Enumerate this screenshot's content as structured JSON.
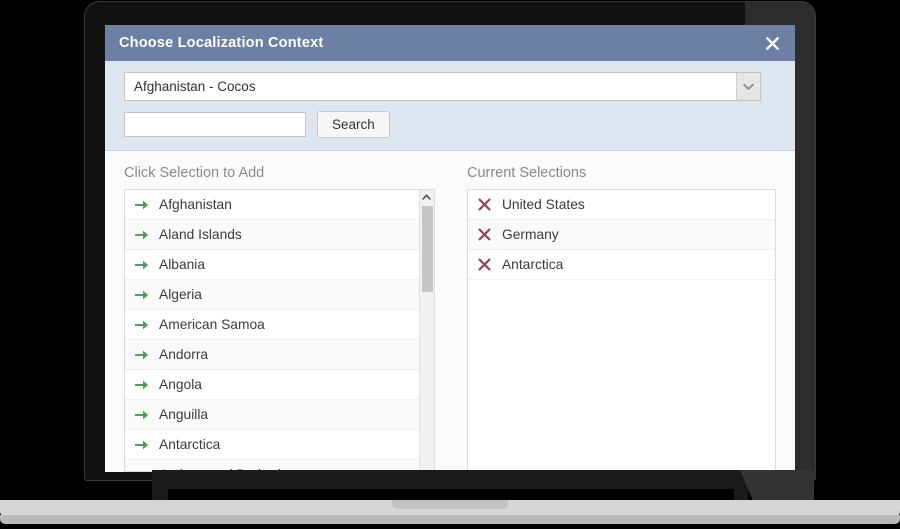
{
  "dialog": {
    "title": "Choose Localization Context",
    "close_icon": "close-icon"
  },
  "context_select": {
    "value": "Afghanistan - Cocos",
    "arrow_icon": "chevron-down-icon"
  },
  "search": {
    "value": "",
    "placeholder": "",
    "button_label": "Search"
  },
  "available": {
    "label": "Click Selection to Add",
    "row_icon": "green-arrow-right-icon",
    "items": [
      "Afghanistan",
      "Aland Islands",
      "Albania",
      "Algeria",
      "American Samoa",
      "Andorra",
      "Angola",
      "Anguilla",
      "Antarctica",
      "Antigua and Barbuda"
    ],
    "scrollbar": {
      "up_icon": "chevron-up-icon"
    }
  },
  "selected": {
    "label": "Current Selections",
    "row_icon": "remove-x-icon",
    "items": [
      "United States",
      "Germany",
      "Antarctica"
    ]
  },
  "colors": {
    "titlebar": "#6b80a4",
    "header_band": "#dde5ee",
    "add_arrow": "#4f9e5e",
    "remove_x": "#9e3a5c"
  }
}
